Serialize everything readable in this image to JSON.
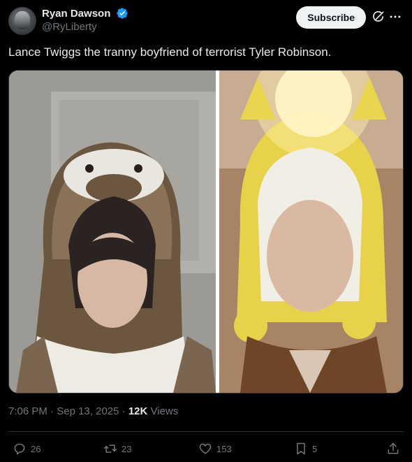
{
  "author": {
    "display_name": "Ryan Dawson",
    "handle": "@RyLiberty",
    "verified": true,
    "verified_color": "#1d9bf0"
  },
  "header": {
    "subscribe_label": "Subscribe"
  },
  "tweet": {
    "text": "Lance Twiggs the tranny boyfriend of terrorist Tyler Robinson.",
    "time": "7:06 PM",
    "date": "Sep 13, 2025",
    "views_count": "12K",
    "views_label": "Views"
  },
  "media": {
    "photos": [
      "photo-left",
      "photo-right"
    ]
  },
  "actions": {
    "replies": "26",
    "reposts": "23",
    "likes": "153",
    "bookmarks": "5"
  },
  "icons": [
    "grok-icon",
    "more-icon",
    "verified-badge-icon",
    "reply-icon",
    "retweet-icon",
    "like-icon",
    "bookmark-icon",
    "share-icon"
  ]
}
